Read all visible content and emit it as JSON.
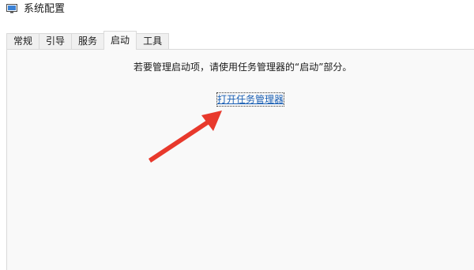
{
  "window": {
    "title": "系统配置",
    "icon": "msconfig-icon"
  },
  "tabs": [
    {
      "label": "常规",
      "active": false
    },
    {
      "label": "引导",
      "active": false
    },
    {
      "label": "服务",
      "active": false
    },
    {
      "label": "启动",
      "active": true
    },
    {
      "label": "工具",
      "active": false
    }
  ],
  "startup": {
    "message": "若要管理启动项，请使用任务管理器的“启动”部分。",
    "link_label": "打开任务管理器"
  },
  "annotation": {
    "arrow_color": "#e8392c",
    "arrow_target": "open-task-manager-link"
  }
}
